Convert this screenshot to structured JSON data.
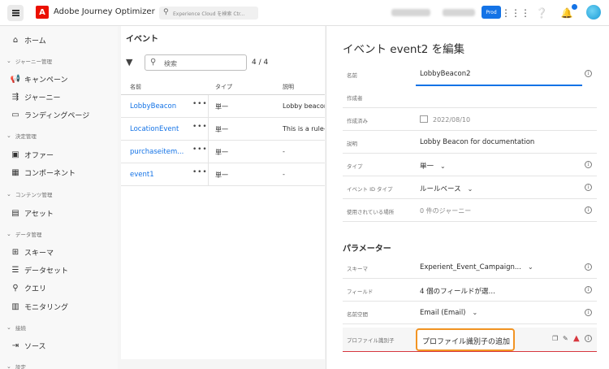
{
  "app": {
    "title": "Adobe Journey Optimizer",
    "logo_letter": "A"
  },
  "topbar": {
    "search_placeholder": "Experience Cloud を検索 Ctr...",
    "prod_badge": "Prod",
    "icons": [
      "grid-icon",
      "help-icon",
      "bell-icon",
      "avatar"
    ]
  },
  "sidebar": {
    "home": "ホーム",
    "sections": [
      {
        "title": "ジャーニー管理",
        "items": [
          "キャンペーン",
          "ジャーニー",
          "ランディングページ"
        ]
      },
      {
        "title": "決定管理",
        "items": [
          "オファー",
          "コンポーネント"
        ]
      },
      {
        "title": "コンテンツ管理",
        "items": [
          "アセット"
        ]
      },
      {
        "title": "データ管理",
        "items": [
          "スキーマ",
          "データセット",
          "クエリ",
          "モニタリング"
        ]
      },
      {
        "title": "接続",
        "items": [
          "ソース"
        ]
      },
      {
        "title": "設定",
        "items": []
      }
    ]
  },
  "list": {
    "title": "イベント",
    "search_placeholder": "検索",
    "count": "4 / 4",
    "columns": [
      "名前",
      "タイプ",
      "説明"
    ],
    "rows": [
      {
        "name": "LobbyBeacon",
        "type": "単一",
        "desc": "Lobby beacon"
      },
      {
        "name": "LocationEvent",
        "type": "単一",
        "desc": "This is a rule-b"
      },
      {
        "name": "purchaseitem...",
        "type": "単一",
        "desc": "-"
      },
      {
        "name": "event1",
        "type": "単一",
        "desc": "-"
      }
    ]
  },
  "edit": {
    "title": "イベント event2 を編集",
    "fields": [
      {
        "label": "名前",
        "value": "LobbyBeacon2"
      },
      {
        "label": "作成者",
        "value": ""
      },
      {
        "label": "作成済み",
        "value": "2022/08/10"
      },
      {
        "label": "説明",
        "value": "Lobby Beacon for documentation"
      },
      {
        "label": "タイプ",
        "value": "単一"
      },
      {
        "label": "イベント ID タイプ",
        "value": "ルールベース"
      },
      {
        "label": "使用されている場所",
        "value": "0 件のジャーニー"
      }
    ],
    "params_title": "パラメーター",
    "params": [
      {
        "label": "スキーマ",
        "value": "Experient_Event_Campaign..."
      },
      {
        "label": "フィールド",
        "value": "4 個のフィールドが選…"
      },
      {
        "label": "名前空間",
        "value": "Email (Email)"
      },
      {
        "label": "プロファイル識別子",
        "value": "プロファイル識別子の追加"
      }
    ]
  }
}
